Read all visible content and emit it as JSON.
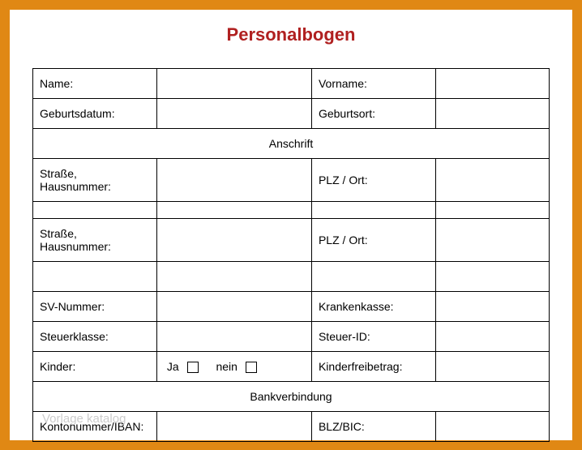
{
  "title": "Personalbogen",
  "labels": {
    "name": "Name:",
    "vorname": "Vorname:",
    "geburtsdatum": "Geburtsdatum:",
    "geburtsort": "Geburtsort:",
    "anschrift": "Anschrift",
    "strasse1": "Straße, Hausnummer:",
    "plzort1": "PLZ / Ort:",
    "strasse2": "Straße, Hausnummer:",
    "plzort2": "PLZ / Ort:",
    "svnummer": "SV-Nummer:",
    "krankenkasse": "Krankenkasse:",
    "steuerklasse": "Steuerklasse:",
    "steuerid": "Steuer-ID:",
    "kinder": "Kinder:",
    "ja": "Ja",
    "nein": "nein",
    "kinderfreibetrag": "Kinderfreibetrag:",
    "bankverbindung": "Bankverbindung",
    "kontonummer": "Kontonummer/IBAN:",
    "blzbic": "BLZ/BIC:"
  },
  "watermark": "Vorlage katalog"
}
